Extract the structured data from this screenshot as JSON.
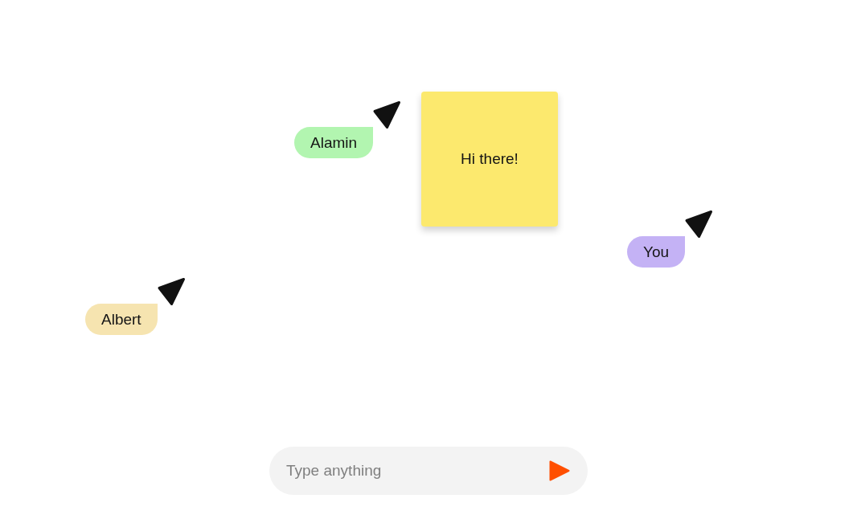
{
  "sticky_note": {
    "text": "Hi there!"
  },
  "cursors": [
    {
      "name": "Alamin",
      "color": "#b2f5b0"
    },
    {
      "name": "You",
      "color": "#c4b2f5"
    },
    {
      "name": "Albert",
      "color": "#f6e4b0"
    }
  ],
  "message_box": {
    "placeholder": "Type anything"
  }
}
